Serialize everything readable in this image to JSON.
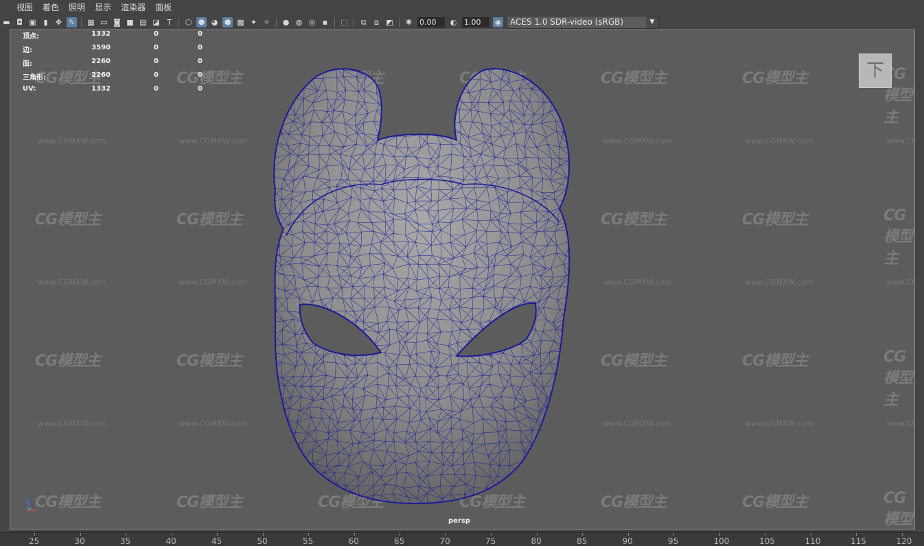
{
  "menubar": {
    "items": [
      "视图",
      "着色",
      "照明",
      "显示",
      "渲染器",
      "面板"
    ]
  },
  "toolbar": {
    "exposure_value": "0.00",
    "gamma_value": "1.00",
    "color_space": "ACES 1.0 SDR-video (sRGB)",
    "icons": [
      "camera-icon",
      "camera-attributes-icon",
      "bookmark-icon",
      "image-plane-icon",
      "pan-icon",
      "grease-pencil-icon",
      "grid-icon",
      "film-gate-icon",
      "resolution-gate-icon",
      "gate-mask-icon",
      "field-chart-icon",
      "safe-action-icon",
      "safe-title-icon",
      "wireframe-icon",
      "smooth-shade-icon",
      "shaded-wireframe-icon",
      "wireframe-on-shaded-icon",
      "xray-icon",
      "textured-icon",
      "use-lights-icon",
      "shadows-icon",
      "ambient-occlusion-icon",
      "motion-blur-icon",
      "anti-alias-icon",
      "depth-of-field-icon",
      "isolate-select-icon",
      "xray-joints-icon",
      "xray-active-icon",
      "backface-icon",
      "exposure-icon",
      "gamma-icon",
      "color-management-icon"
    ]
  },
  "hud": {
    "rows": [
      {
        "label": "顶点:",
        "v1": "1332",
        "v2": "0",
        "v3": "0"
      },
      {
        "label": "边:",
        "v1": "3590",
        "v2": "0",
        "v3": "0"
      },
      {
        "label": "面:",
        "v1": "2260",
        "v2": "0",
        "v3": "0"
      },
      {
        "label": "三角形:",
        "v1": "2260",
        "v2": "0",
        "v3": "0"
      },
      {
        "label": "UV:",
        "v1": "1332",
        "v2": "0",
        "v3": "0"
      }
    ]
  },
  "viewport": {
    "camera_label": "persp",
    "view_cube_label": "下",
    "watermark_logo": "CG模型主",
    "watermark_url": "www.CGMXW.com",
    "wire_color": "#1b1b9a",
    "mesh_color": "#8c8c8c",
    "background_color": "#5c5c5c"
  },
  "ruler": {
    "ticks": [
      "25",
      "30",
      "35",
      "40",
      "45",
      "50",
      "55",
      "60",
      "65",
      "70",
      "75",
      "80",
      "85",
      "90",
      "95",
      "100",
      "105",
      "110",
      "115",
      "120"
    ]
  }
}
